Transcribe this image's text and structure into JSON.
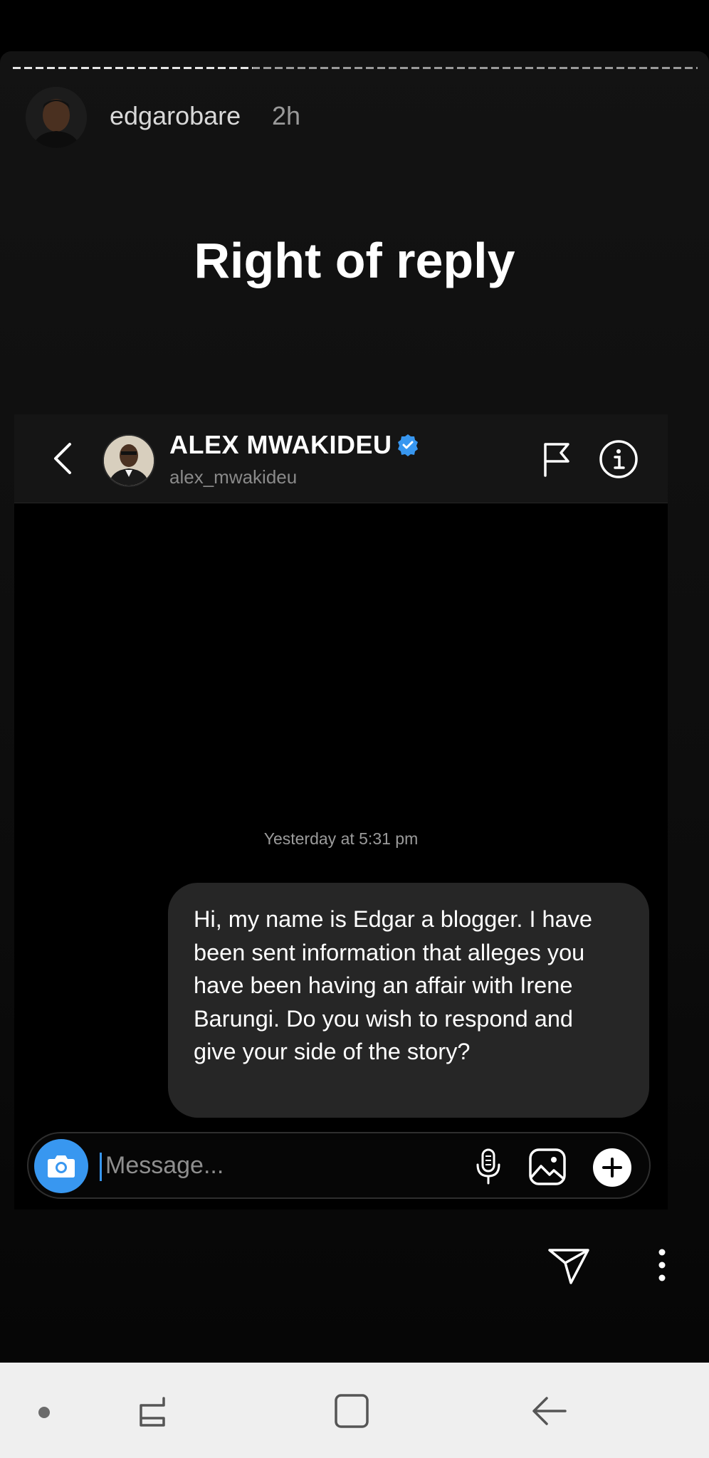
{
  "story": {
    "username": "edgarobare",
    "time_ago": "2h",
    "title": "Right of reply",
    "progress": 0.35
  },
  "chat": {
    "name": "ALEX MWAKIDEU",
    "handle": "alex_mwakideu",
    "verified": true,
    "timestamp": "Yesterday at 5:31 pm",
    "message": "Hi, my name is Edgar a blogger. I have been sent information that alleges you have been having an affair with Irene Barungi. Do you wish to respond and give your side of the story?",
    "input_placeholder": "Message..."
  },
  "colors": {
    "accent": "#3897f0",
    "bubble": "#262626",
    "background": "#000000"
  },
  "icons": {
    "header": [
      "back-icon",
      "flag-icon",
      "info-icon",
      "verified-badge-icon"
    ],
    "composer": [
      "camera-icon",
      "microphone-icon",
      "gallery-icon",
      "plus-icon"
    ],
    "story_footer": [
      "send-icon",
      "more-icon"
    ],
    "navbar": [
      "recents-icon",
      "home-icon",
      "back-icon"
    ]
  }
}
